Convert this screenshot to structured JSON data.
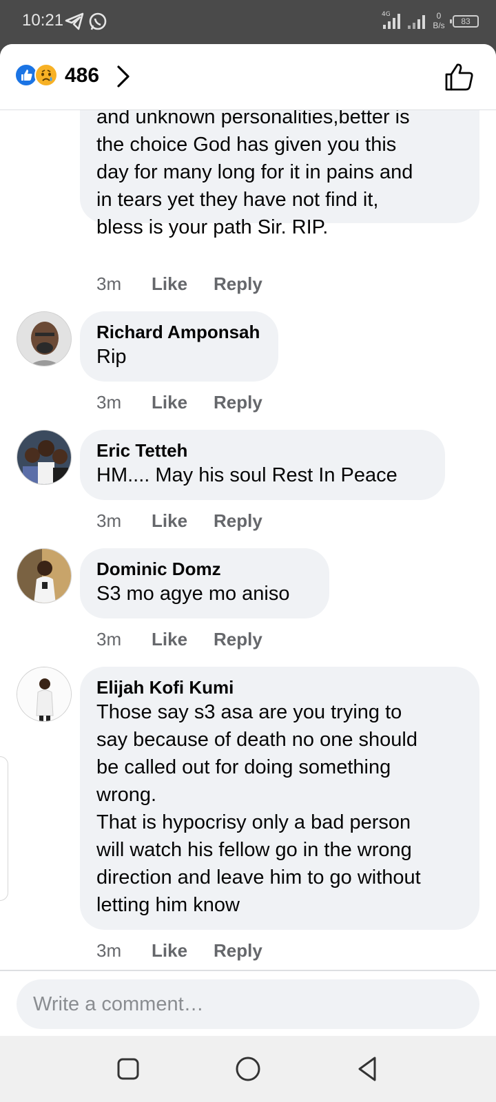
{
  "status_bar": {
    "time": "10:21",
    "network": "4G",
    "speed_value": "0",
    "speed_unit": "B/s",
    "battery": "83"
  },
  "header": {
    "reaction_count": "486",
    "reactions": [
      "like-icon",
      "sad-icon"
    ]
  },
  "comments": [
    {
      "author": "",
      "text_lines": [
        "and unknown personalities,better is",
        "the choice God has given you this",
        "day for many long for it in pains and",
        "in tears yet they have not find it,",
        "bless is your path Sir. RIP."
      ],
      "time": "3m",
      "like": "Like",
      "reply": "Reply"
    },
    {
      "author": "Richard Amponsah",
      "text_lines": [
        "Rip"
      ],
      "time": "3m",
      "like": "Like",
      "reply": "Reply"
    },
    {
      "author": "Eric Tetteh",
      "text_lines": [
        "HM.... May his soul Rest In Peace"
      ],
      "time": "3m",
      "like": "Like",
      "reply": "Reply"
    },
    {
      "author": "Dominic Domz",
      "text_lines": [
        "S3 mo agye mo aniso"
      ],
      "time": "3m",
      "like": "Like",
      "reply": "Reply"
    },
    {
      "author": "Elijah Kofi Kumi",
      "text_lines": [
        "Those say s3 asa are you trying to",
        "say because of death no one should",
        "be called out for doing something",
        "wrong.",
        "That is hypocrisy only a bad person",
        "will watch his fellow go in the wrong",
        "direction and leave him to go without",
        "letting him know"
      ],
      "time": "3m",
      "like": "Like",
      "reply": "Reply"
    }
  ],
  "composer": {
    "placeholder": "Write a comment…"
  },
  "colors": {
    "bubble": "#f0f2f5",
    "like_blue": "#1b74e4",
    "sad_yellow": "#f7b125",
    "meta_gray": "#65676b"
  }
}
